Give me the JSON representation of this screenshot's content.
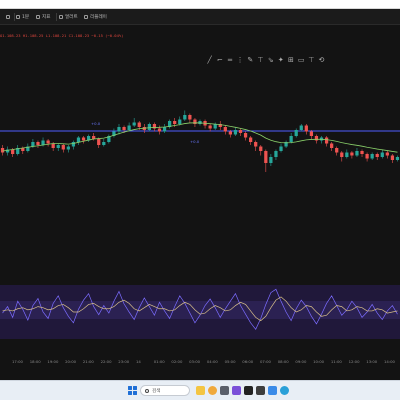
{
  "toolbar": {
    "items": [
      {
        "label": "1분",
        "icon": "interval-icon"
      },
      {
        "label": "지표",
        "icon": "indicator-icon"
      },
      {
        "label": "얼러트",
        "icon": "alert-icon"
      },
      {
        "label": "리플레이",
        "icon": "replay-icon"
      }
    ]
  },
  "ohlc": {
    "text": "O1.108.23 H1.108.25 L1.108.21 C1.108.23 −0.15 (−0.04%)"
  },
  "drawing_tools": [
    "╱",
    "⌐",
    "═",
    "⋮",
    "✎",
    "⊤",
    "⇘",
    "✦",
    "⊞",
    "▭",
    "⊤",
    "⟲"
  ],
  "price_panel": {
    "level_line_color": "#4f5dff",
    "level_labels": [
      "+0.0",
      "+0.0"
    ]
  },
  "chart_data": {
    "type": "candlestick",
    "candles": [
      [
        22,
        19,
        24,
        17
      ],
      [
        19,
        21,
        23,
        17
      ],
      [
        21,
        18,
        22,
        16
      ],
      [
        18,
        22,
        24,
        17
      ],
      [
        22,
        20,
        23,
        18
      ],
      [
        20,
        23,
        25,
        19
      ],
      [
        23,
        26,
        28,
        22
      ],
      [
        26,
        24,
        27,
        22
      ],
      [
        24,
        27,
        29,
        23
      ],
      [
        27,
        25,
        28,
        23
      ],
      [
        25,
        22,
        26,
        20
      ],
      [
        22,
        24,
        25,
        20
      ],
      [
        24,
        21,
        25,
        19
      ],
      [
        21,
        23,
        24,
        19
      ],
      [
        23,
        26,
        27,
        21
      ],
      [
        26,
        29,
        30,
        24
      ],
      [
        29,
        27,
        30,
        25
      ],
      [
        27,
        30,
        31,
        26
      ],
      [
        30,
        28,
        32,
        27
      ],
      [
        28,
        24,
        29,
        22
      ],
      [
        24,
        26,
        28,
        23
      ],
      [
        26,
        30,
        31,
        25
      ],
      [
        30,
        33,
        35,
        29
      ],
      [
        33,
        36,
        38,
        31
      ],
      [
        36,
        34,
        37,
        32
      ],
      [
        34,
        37,
        39,
        33
      ],
      [
        37,
        39,
        42,
        36
      ],
      [
        39,
        36,
        40,
        34
      ],
      [
        36,
        34,
        38,
        32
      ],
      [
        34,
        38,
        39,
        33
      ],
      [
        38,
        35,
        39,
        33
      ],
      [
        35,
        33,
        37,
        31
      ],
      [
        33,
        36,
        38,
        32
      ],
      [
        36,
        40,
        41,
        35
      ],
      [
        40,
        38,
        42,
        36
      ],
      [
        38,
        41,
        43,
        37
      ],
      [
        41,
        44,
        47,
        40
      ],
      [
        44,
        41,
        45,
        39
      ],
      [
        41,
        38,
        42,
        36
      ],
      [
        38,
        40,
        41,
        37
      ],
      [
        40,
        37,
        41,
        35
      ],
      [
        37,
        35,
        38,
        33
      ],
      [
        35,
        38,
        39,
        34
      ],
      [
        38,
        36,
        40,
        34
      ],
      [
        36,
        33,
        37,
        31
      ],
      [
        33,
        31,
        34,
        29
      ],
      [
        31,
        34,
        36,
        30
      ],
      [
        34,
        32,
        35,
        30
      ],
      [
        32,
        29,
        33,
        27
      ],
      [
        29,
        26,
        30,
        24
      ],
      [
        26,
        23,
        27,
        20
      ],
      [
        23,
        20,
        24,
        17
      ],
      [
        20,
        12,
        21,
        6
      ],
      [
        12,
        16,
        18,
        10
      ],
      [
        16,
        20,
        21,
        14
      ],
      [
        20,
        23,
        25,
        19
      ],
      [
        23,
        26,
        27,
        22
      ],
      [
        26,
        30,
        32,
        25
      ],
      [
        30,
        34,
        35,
        29
      ],
      [
        34,
        37,
        38,
        33
      ],
      [
        37,
        33,
        38,
        31
      ],
      [
        33,
        30,
        34,
        28
      ],
      [
        30,
        27,
        31,
        25
      ],
      [
        27,
        29,
        30,
        25
      ],
      [
        29,
        25,
        30,
        23
      ],
      [
        25,
        22,
        26,
        20
      ],
      [
        22,
        19,
        23,
        17
      ],
      [
        19,
        16,
        20,
        13
      ],
      [
        16,
        19,
        21,
        15
      ],
      [
        19,
        17,
        20,
        15
      ],
      [
        17,
        20,
        22,
        16
      ],
      [
        20,
        18,
        21,
        16
      ],
      [
        18,
        15,
        19,
        13
      ],
      [
        15,
        18,
        19,
        14
      ],
      [
        18,
        16,
        19,
        14
      ],
      [
        16,
        19,
        21,
        15
      ],
      [
        19,
        17,
        20,
        15
      ],
      [
        17,
        14,
        18,
        12
      ],
      [
        14,
        16,
        17,
        13
      ]
    ],
    "ma": [
      20,
      20.5,
      21,
      21.5,
      22,
      22.5,
      23,
      23.5,
      24,
      24.5,
      25,
      25,
      24.8,
      24.6,
      25,
      25.8,
      26.5,
      27.3,
      28,
      28.3,
      28.6,
      29.4,
      30.5,
      31.6,
      32.6,
      33.5,
      34.3,
      34.9,
      35.2,
      35.5,
      35.7,
      35.8,
      36,
      36.4,
      37,
      37.6,
      38.3,
      38.7,
      38.8,
      38.7,
      38.5,
      38.2,
      37.9,
      37.6,
      37.1,
      36.4,
      35.8,
      35.1,
      34.3,
      33.3,
      32,
      30.6,
      28.6,
      27.2,
      26.2,
      25.6,
      25.4,
      25.6,
      26.1,
      26.8,
      27.4,
      27.7,
      27.8,
      27.8,
      27.6,
      27.1,
      26.4,
      25.6,
      24.9,
      24.3,
      23.8,
      23.2,
      22.5,
      21.9,
      21.3,
      20.8,
      20.3,
      19.7,
      19.2
    ],
    "oscillator": {
      "fast": [
        48,
        60,
        40,
        70,
        55,
        35,
        62,
        75,
        50,
        38,
        66,
        80,
        58,
        42,
        30,
        55,
        72,
        84,
        60,
        45,
        62,
        48,
        70,
        88,
        65,
        50,
        36,
        58,
        76,
        60,
        44,
        68,
        52,
        38,
        60,
        80,
        66,
        48,
        30,
        44,
        62,
        74,
        58,
        40,
        56,
        70,
        84,
        62,
        46,
        30,
        18,
        38,
        64,
        86,
        92,
        70,
        50,
        34,
        56,
        72,
        60,
        42,
        28,
        46,
        66,
        80,
        62,
        44,
        54,
        70,
        58,
        40,
        50,
        64,
        48,
        36,
        52,
        62,
        46
      ],
      "slow": [
        52,
        54,
        52,
        56,
        58,
        54,
        56,
        60,
        58,
        54,
        56,
        62,
        64,
        58,
        50,
        50,
        56,
        64,
        66,
        60,
        56,
        56,
        60,
        68,
        72,
        66,
        56,
        52,
        58,
        64,
        60,
        56,
        56,
        52,
        54,
        62,
        68,
        64,
        54,
        46,
        48,
        56,
        62,
        58,
        52,
        54,
        62,
        68,
        64,
        52,
        40,
        34,
        42,
        58,
        72,
        78,
        70,
        58,
        50,
        54,
        62,
        60,
        50,
        42,
        44,
        54,
        62,
        60,
        52,
        54,
        60,
        58,
        52,
        52,
        56,
        54,
        48,
        50,
        52
      ]
    },
    "x_tick_labels": [
      "17:00",
      "18:00",
      "19:00",
      "20:00",
      "21:00",
      "22:00",
      "23:00",
      "14",
      "01:00",
      "02:00",
      "03:00",
      "04:00",
      "05:00",
      "06:00",
      "07:00",
      "08:00",
      "09:00",
      "10:00",
      "11:00",
      "12:00",
      "13:00",
      "14:00"
    ]
  },
  "taskbar": {
    "search_placeholder": "검색",
    "pinned": [
      "file-explorer-icon",
      "weather-icon",
      "camera-icon",
      "chat-icon",
      "media-icon",
      "terminal-icon",
      "store-icon",
      "browser-icon"
    ],
    "colors": {
      "start": "#1f6fd6"
    }
  }
}
